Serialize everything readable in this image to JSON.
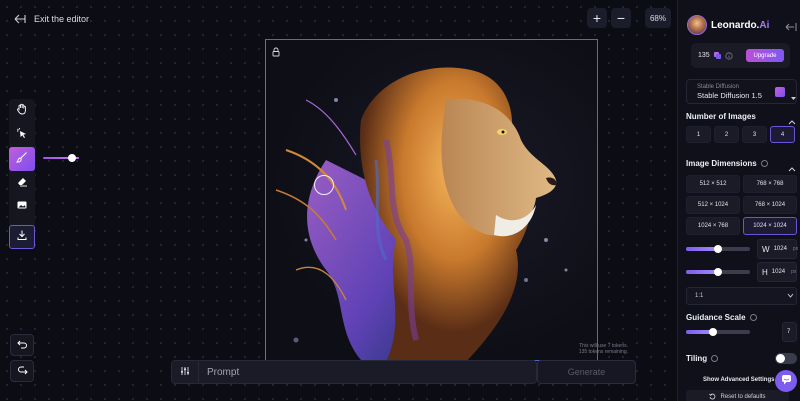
{
  "editor": {
    "exit_label": "Exit the editor",
    "zoom": {
      "in_label": "+",
      "out_label": "−",
      "level": "68%"
    },
    "tools": [
      {
        "name": "hand-tool",
        "icon": "hand-icon"
      },
      {
        "name": "select-tool",
        "icon": "magic-pointer-icon"
      },
      {
        "name": "brush-tool",
        "icon": "paintbrush-icon",
        "active": true
      },
      {
        "name": "eraser-tool",
        "icon": "eraser-icon"
      },
      {
        "name": "image-tool",
        "icon": "image-icon"
      },
      {
        "name": "download-tool",
        "icon": "download-icon"
      }
    ],
    "brush_size_fraction": 0.8,
    "generation_info": {
      "line1": "This will use 7 tokens.",
      "line2": "135 tokens remaining."
    },
    "prompt": {
      "placeholder": "Prompt",
      "value": ""
    },
    "generate_label": "Generate"
  },
  "panel": {
    "brand": {
      "name": "Leonardo.",
      "suffix": "Ai"
    },
    "tokens": {
      "count": "135",
      "upgrade_label": "Upgrade"
    },
    "model": {
      "label": "Stable Diffusion",
      "value": "Stable Diffusion 1.5"
    },
    "num_images": {
      "title": "Number of Images",
      "options": [
        "1",
        "2",
        "3",
        "4"
      ],
      "selected": "4"
    },
    "dimensions": {
      "title": "Image Dimensions",
      "options": [
        "512 × 512",
        "768 × 768",
        "512 × 1024",
        "768 × 1024",
        "1024 × 768",
        "1024 × 1024"
      ],
      "selected": "1024 × 1024",
      "width": {
        "axis": "W",
        "value": "1024",
        "unit": "px",
        "fraction": 0.5
      },
      "height": {
        "axis": "H",
        "value": "1024",
        "unit": "px",
        "fraction": 0.5
      },
      "aspect_ratio": "1:1"
    },
    "guidance": {
      "title": "Guidance Scale",
      "value": "7",
      "fraction": 0.42
    },
    "tiling": {
      "title": "Tiling",
      "enabled": false
    },
    "advanced_label": "Show Advanced Settings",
    "reset_label": "Reset to defaults"
  },
  "colors": {
    "accent": "#7d5cf0",
    "accent_pink": "#c15ed9",
    "background": "#0b0c14",
    "panel": "#0f1019"
  }
}
